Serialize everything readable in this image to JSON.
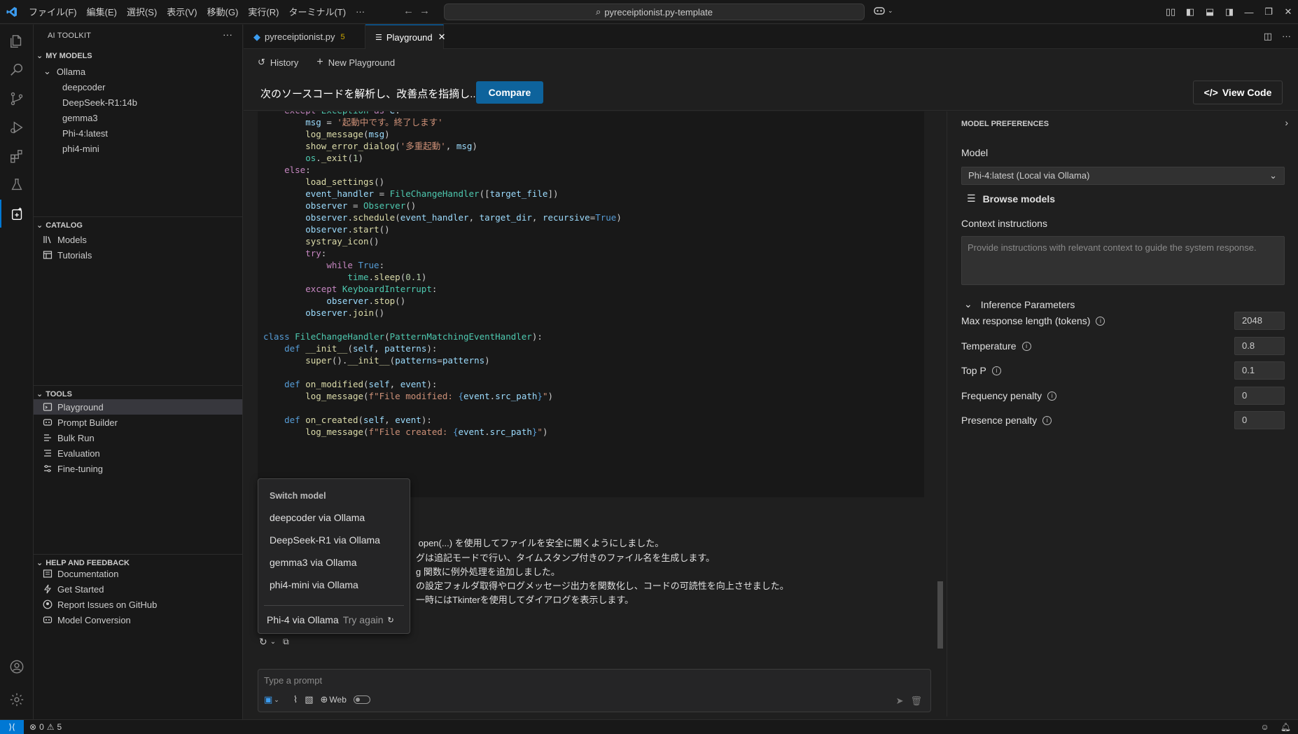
{
  "menubar": {
    "items": [
      "ファイル(F)",
      "編集(E)",
      "選択(S)",
      "表示(V)",
      "移動(G)",
      "実行(R)",
      "ターミナル(T)",
      "···"
    ],
    "search": "pyreceiptionist.py-template"
  },
  "sidebar": {
    "header": "AI TOOLKIT",
    "my_models_title": "MY MODELS",
    "ollama_label": "Ollama",
    "models": [
      "deepcoder",
      "DeepSeek-R1:14b",
      "gemma3",
      "Phi-4:latest",
      "phi4-mini"
    ],
    "catalog_title": "CATALOG",
    "catalog_items": [
      "Models",
      "Tutorials"
    ],
    "tools_title": "TOOLS",
    "tools_items": [
      "Playground",
      "Prompt Builder",
      "Bulk Run",
      "Evaluation",
      "Fine-tuning"
    ],
    "help_title": "HELP AND FEEDBACK",
    "help_items": [
      "Documentation",
      "Get Started",
      "Report Issues on GitHub",
      "Model Conversion"
    ]
  },
  "tabs": [
    {
      "label": "pyreceiptionist.py",
      "badge": "5"
    },
    {
      "label": "Playground"
    }
  ],
  "toolbar": {
    "history": "History",
    "new_playground": "New Playground"
  },
  "compare": {
    "prompt_title": "次のソースコードを解析し、改善点を指摘し...",
    "compare_button": "Compare",
    "view_code_button": "View Code"
  },
  "response": {
    "lines": [
      " open(...) を使用してファイルを安全に開くようにしました。",
      "グは追記モードで行い、タイムスタンプ付きのファイル名を生成します。",
      "g 関数に例外処理を追加しました。",
      "の設定フォルダ取得やログメッセージ出力を関数化し、コードの可読性を向上させました。",
      "一時にはTkinterを使用してダイアログを表示します。"
    ]
  },
  "switch_menu": {
    "title": "Switch model",
    "items": [
      "deepcoder via Ollama",
      "DeepSeek-R1 via Ollama",
      "gemma3 via Ollama",
      "phi4-mini via Ollama"
    ],
    "footer_model": "Phi-4 via Ollama",
    "footer_action": "Try again"
  },
  "prompt": {
    "placeholder": "Type a prompt",
    "web_label": "Web"
  },
  "prefs": {
    "title": "MODEL PREFERENCES",
    "model_label": "Model",
    "model_value": "Phi-4:latest (Local via Ollama)",
    "browse": "Browse models",
    "context_label": "Context instructions",
    "context_placeholder": "Provide instructions with relevant context to guide the system response.",
    "inference_title": "Inference Parameters",
    "params": [
      {
        "label": "Max response length (tokens)",
        "value": "2048"
      },
      {
        "label": "Temperature",
        "value": "0.8"
      },
      {
        "label": "Top P",
        "value": "0.1"
      },
      {
        "label": "Frequency penalty",
        "value": "0"
      },
      {
        "label": "Presence penalty",
        "value": "0"
      }
    ]
  },
  "status": {
    "errors": "0",
    "warnings": "5"
  },
  "colors": {
    "accent": "#0078d4",
    "compare_button": "#0e639c",
    "background": "#1f1f1f",
    "sidebar": "#181818"
  }
}
